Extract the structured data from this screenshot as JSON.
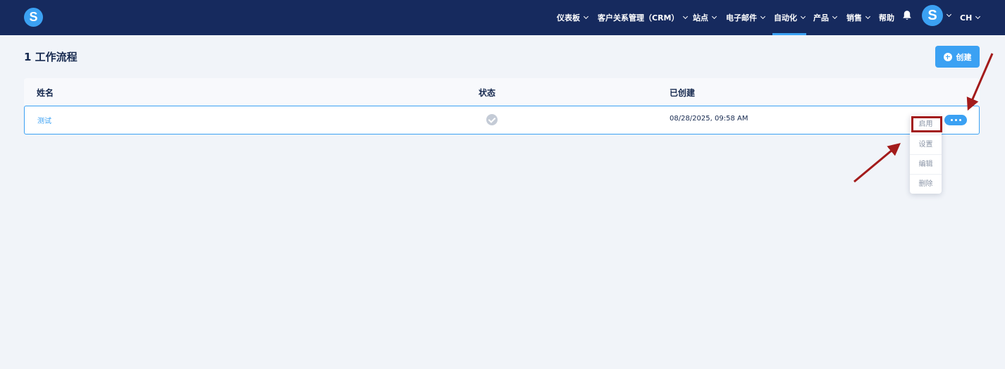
{
  "app": {
    "logo_letter": "S"
  },
  "nav": {
    "items": [
      {
        "label": "仪表板",
        "dropdown": true
      },
      {
        "label": "客户关系管理（CRM）",
        "dropdown": true
      },
      {
        "label": "站点",
        "dropdown": true
      },
      {
        "label": "电子邮件",
        "dropdown": true
      },
      {
        "label": "自动化",
        "dropdown": true,
        "active": true
      },
      {
        "label": "产品",
        "dropdown": true
      },
      {
        "label": "销售",
        "dropdown": true
      },
      {
        "label": "帮助",
        "dropdown": false
      }
    ],
    "avatar_letter": "S",
    "language": "CH"
  },
  "page": {
    "title": "1 工作流程",
    "create_label": "创建"
  },
  "table": {
    "columns": [
      "姓名",
      "状态",
      "已创建"
    ],
    "rows": [
      {
        "name": "测试",
        "status": "enabled-check",
        "created": "08/28/2025, 09:58 AM"
      }
    ]
  },
  "row_menu": {
    "items": [
      "启用",
      "设置",
      "编辑",
      "删除"
    ],
    "highlighted": "启用"
  },
  "colors": {
    "topbar": "#162a5e",
    "accent": "#3ba1f3",
    "background": "#f1f4f9",
    "annotation": "#a31b1b"
  },
  "icons": [
    "logo-icon",
    "chevron-down-icon",
    "bell-icon",
    "plus-circle-icon",
    "check-circle-icon",
    "more-dots-icon",
    "arrow-annotation"
  ]
}
